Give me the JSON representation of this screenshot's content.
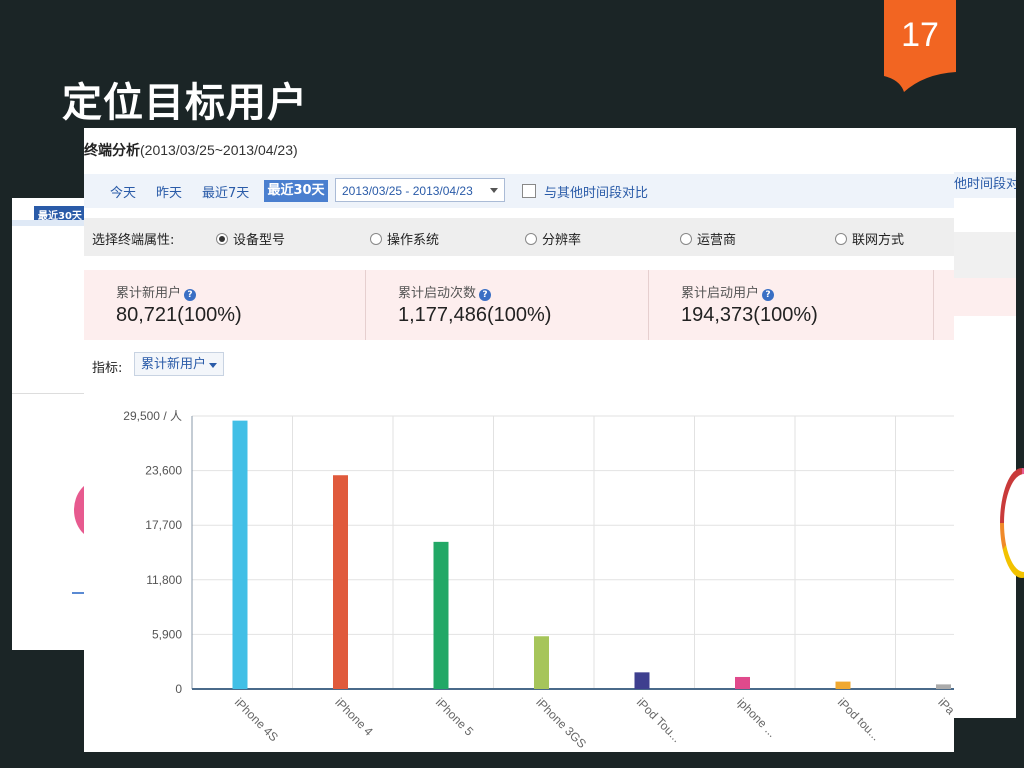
{
  "slide": {
    "title": "定位目标用户",
    "page_number": "17",
    "accent_color": "#f26522"
  },
  "bg_left": {
    "tag": "最近30天"
  },
  "bg_right": {
    "header": "他时间段对"
  },
  "panel": {
    "title_bold": "终端分析",
    "title_range": "(2013/03/25~2013/04/23)",
    "toolbar": {
      "buttons": [
        "今天",
        "昨天",
        "最近7天"
      ],
      "active_button": "最近30天",
      "date_range": "2013/03/25 - 2013/04/23",
      "compare_label": "与其他时间段对比"
    },
    "attributes": {
      "label": "选择终端属性:",
      "options": [
        "设备型号",
        "操作系统",
        "分辨率",
        "运营商",
        "联网方式"
      ],
      "selected_index": 0
    },
    "stats": [
      {
        "label": "累计新用户",
        "value": "80,721(100%)"
      },
      {
        "label": "累计启动次数",
        "value": "1,177,486(100%)"
      },
      {
        "label": "累计启动用户",
        "value": "194,373(100%)"
      }
    ],
    "metric": {
      "label": "指标:",
      "selected": "累计新用户"
    }
  },
  "chart_data": {
    "type": "bar",
    "categories": [
      "iPhone 4S",
      "iPhone 4",
      "iPhone 5",
      "iPhone 3GS",
      "iPod Tou...",
      "iphone ...",
      "iPod tou...",
      "iPa"
    ],
    "values": [
      29000,
      23100,
      15900,
      5700,
      1800,
      1300,
      800,
      500
    ],
    "colors": [
      "#41bfe6",
      "#e05a3c",
      "#22a866",
      "#a6c55a",
      "#3e3f8f",
      "#e04a8c",
      "#f0a830",
      "#aaaaaa"
    ],
    "ylim": [
      0,
      29500
    ],
    "yticks": [
      "0",
      "5,900",
      "11,800",
      "17,700",
      "23,600",
      "29,500 / 人"
    ],
    "ytick_values": [
      0,
      5900,
      11800,
      17700,
      23600,
      29500
    ],
    "grid": true
  }
}
